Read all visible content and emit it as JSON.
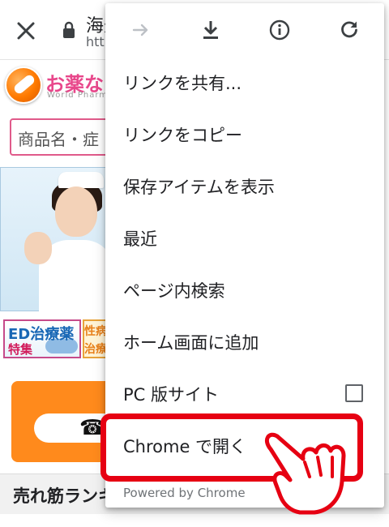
{
  "toolbar": {
    "close_icon": "close-icon",
    "lock_icon": "lock-icon",
    "title": "海外",
    "url": "http"
  },
  "site": {
    "logo_text": "お薬な",
    "logo_sub": "World Pharma",
    "search_placeholder": "商品名・症",
    "ed_title": "ED治療薬",
    "ed_sub": "特集",
    "ed2_a": "性病",
    "ed2_b": "治療",
    "phone_glyph": "☎",
    "ranking": "売れ筋ランキ"
  },
  "menu": {
    "icons": [
      "forward-arrow-icon",
      "download-icon",
      "info-icon",
      "refresh-icon"
    ],
    "items": [
      {
        "label": "リンクを共有..."
      },
      {
        "label": "リンクをコピー"
      },
      {
        "label": "保存アイテムを表示"
      },
      {
        "label": "最近"
      },
      {
        "label": "ページ内検索"
      },
      {
        "label": "ホーム画面に追加"
      },
      {
        "label": "PC 版サイト",
        "checked": false
      },
      {
        "label": "Chrome で開く"
      }
    ],
    "footer": "Powered by Chrome"
  },
  "colors": {
    "highlight": "#e60012",
    "accent_pink": "#e05a8a",
    "orange": "#ff8a1c"
  }
}
